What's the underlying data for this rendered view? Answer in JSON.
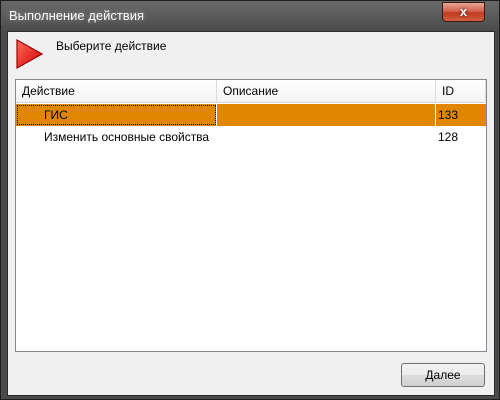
{
  "window": {
    "title": "Выполнение действия",
    "close_glyph": "x"
  },
  "header": {
    "icon": "red-play-triangle-icon",
    "prompt": "Выберите действие"
  },
  "table": {
    "columns": [
      "Действие",
      "Описание",
      "ID"
    ],
    "rows": [
      {
        "action": "ГИС",
        "description": "",
        "id": "133",
        "selected": true
      },
      {
        "action": "Изменить основные свойства",
        "description": "",
        "id": "128",
        "selected": false
      }
    ]
  },
  "footer": {
    "next_label": "Далее"
  },
  "colors": {
    "selection": "#e08600",
    "titlebar": "#4b4b4b",
    "close": "#c23a23"
  }
}
